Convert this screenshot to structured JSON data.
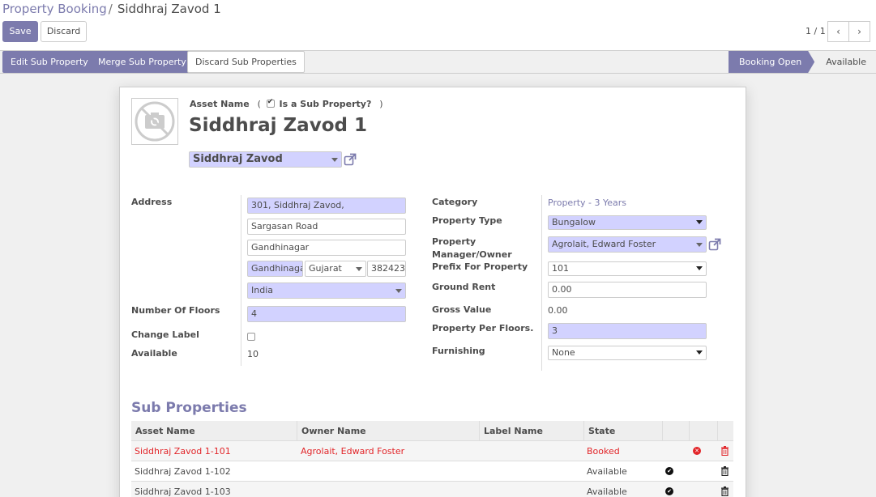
{
  "breadcrumb": {
    "parent": "Property Booking",
    "separator": "/",
    "current": "Siddhraj Zavod 1"
  },
  "buttons": {
    "save": "Save",
    "discard": "Discard"
  },
  "pager": {
    "value": "1 / 1"
  },
  "header_buttons": {
    "edit_sub": "Edit Sub Property",
    "merge_sub": "Merge Sub Property",
    "discard_sub": "Discard Sub Properties"
  },
  "statusbar": {
    "active": "Booking Open",
    "next": "Available"
  },
  "form": {
    "asset_name_label": "Asset Name",
    "sub_property_label": "Is a Sub Property?",
    "paren_open": "(",
    "paren_close": ")",
    "sub_property_checked": true,
    "title": "Siddhraj Zavod 1",
    "parent_property": "Siddhraj Zavod",
    "left": {
      "address_label": "Address",
      "street": "301, Siddhraj Zavod,",
      "street2": "Sargasan Road",
      "township": "Gandhinagar",
      "city": "Gandhinaga",
      "state": "Gujarat",
      "zip": "382423",
      "country": "India",
      "floors_label": "Number Of Floors",
      "floors": "4",
      "change_label_label": "Change Label",
      "available_label": "Available",
      "available": "10"
    },
    "right": {
      "category_label": "Category",
      "category": "Property - 3 Years",
      "type_label": "Property Type",
      "type": "Bungalow",
      "manager_label_1": "Property",
      "manager_label_2": "Manager/Owner",
      "manager": "Agrolait, Edward Foster",
      "prefix_label": "Prefix For Property",
      "prefix": "101",
      "ground_rent_label": "Ground Rent",
      "ground_rent": "0.00",
      "gross_label": "Gross Value",
      "gross": "0.00",
      "per_floor_label": "Property Per Floors.",
      "per_floor": "3",
      "furnishing_label": "Furnishing",
      "furnishing": "None"
    }
  },
  "sub_properties": {
    "title": "Sub Properties",
    "columns": [
      "Asset Name",
      "Owner Name",
      "Label Name",
      "State"
    ],
    "rows": [
      {
        "asset": "Siddhraj Zavod 1-101",
        "owner": "Agrolait, Edward Foster",
        "label": "",
        "state": "Booked"
      },
      {
        "asset": "Siddhraj Zavod 1-102",
        "owner": "",
        "label": "",
        "state": "Available"
      },
      {
        "asset": "Siddhraj Zavod 1-103",
        "owner": "",
        "label": "",
        "state": "Available"
      }
    ]
  },
  "colors": {
    "primary": "#7c7bad",
    "required_bg": "#d2d2ff",
    "booked": "#e2262a"
  }
}
